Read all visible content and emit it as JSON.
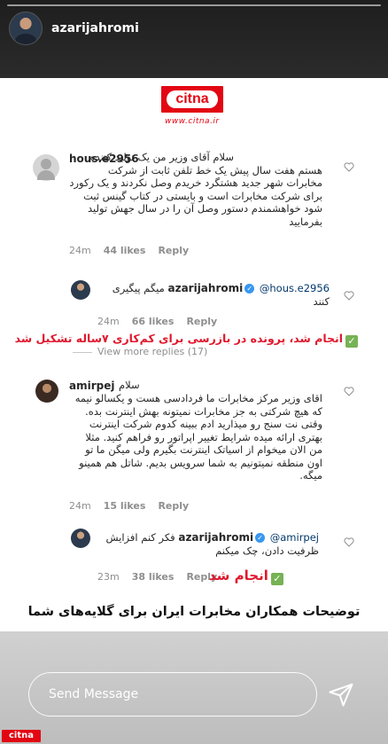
{
  "story": {
    "username": "azarijahromi"
  },
  "logo": {
    "text": "citna",
    "url": "www.citna.ir"
  },
  "comments": [
    {
      "username": "hous.e2956",
      "text": "سلام آقای وزیر من یک تولید کننده هستم هفت سال پیش یک خط تلفن ثابت از شرکت مخابرات شهر جدید هشتگرد خریدم  وصل نکردند و یک رکورد برای شرکت مخابرات است و بایستی در کتاب گینس ثبت شود خواهشمندم دستور وصل آن را در سال جهش تولید بفرمایید",
      "time": "24m",
      "likes": "44 likes",
      "reply": "Reply"
    },
    {
      "username": "azarijahromi",
      "mention": "@hous.e2956",
      "text": "میگم پیگیری کنند",
      "time": "24m",
      "likes": "66 likes",
      "reply": "Reply"
    },
    {
      "username": "amirpej",
      "text_head": "سلام",
      "text": "اقای وزیر مرکز مخابرات ما فردادسی هست و یکسالو نیمه که هیچ شرکتی به جز مخابرات نمیتونه بهش اینترنت بده. وقتی نت سنج رو میذارید ادم ببینه کدوم شرکت اینترنت بهتری ارائه میده شرایط تغییر اپراتور رو فراهم کنید. مثلا من الان میخوام از اسیاتک اینترنت بگیرم ولی میگن ما تو اون منطقه نمیتونیم به شما سرویس بدیم. شاتل هم همینو میگه.",
      "time": "24m",
      "likes": "15 likes",
      "reply": "Reply"
    },
    {
      "username": "azarijahromi",
      "mention": "@amirpej",
      "text": "فکر کنم افزایش ظرفیت دادن، چک میکنم",
      "time": "23m",
      "likes": "38 likes",
      "reply": "Reply"
    }
  ],
  "annotations": {
    "first": "انجام شد، پرونده در بازرسی برای کم‌کاری ۷ساله تشکیل شد",
    "second": "انجام شد"
  },
  "view_more": "View more replies (17)",
  "caption": "توضیحات همکاران مخابرات ایران برای گلایه‌های شما",
  "composer": {
    "placeholder": "Send Message"
  },
  "watermark": "citna",
  "colors": {
    "brand_red": "#e30613",
    "annotation_red": "#e0182d",
    "check_green": "#77b255",
    "verified_blue": "#3897f0"
  }
}
